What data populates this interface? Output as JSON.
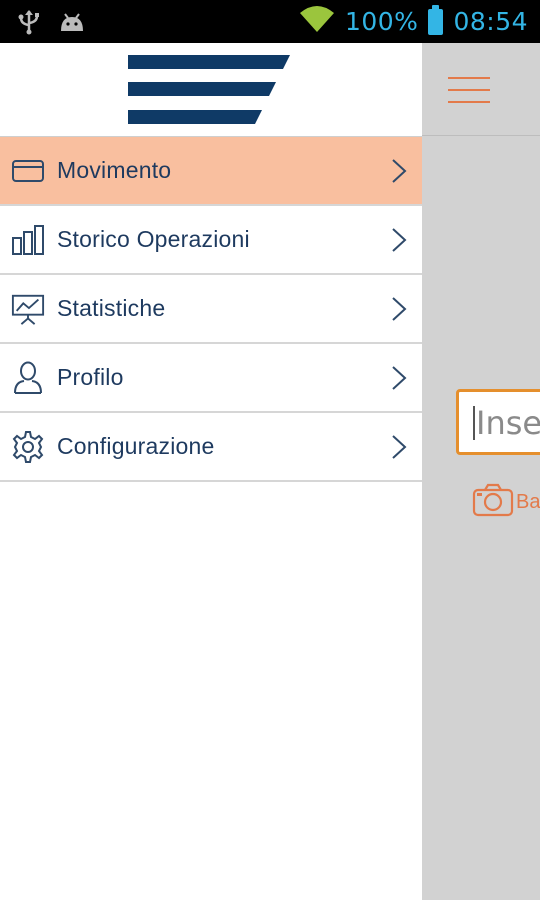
{
  "status_bar": {
    "battery_text": "100%",
    "time": "08:54",
    "icons": [
      "usb-icon",
      "android-debug-icon",
      "wifi-icon",
      "battery-icon"
    ],
    "text_color": "#33b5e5"
  },
  "drawer": {
    "logo": "app-logo",
    "brand_color": "#0f3a66",
    "active_color": "#f9bf9f",
    "items": [
      {
        "label": "Movimento",
        "icon": "card-icon",
        "active": true
      },
      {
        "label": "Storico Operazioni",
        "icon": "bar-chart-icon",
        "active": false
      },
      {
        "label": "Statistiche",
        "icon": "presentation-chart-icon",
        "active": false
      },
      {
        "label": "Profilo",
        "icon": "user-icon",
        "active": false
      },
      {
        "label": "Configurazione",
        "icon": "gear-icon",
        "active": false
      }
    ]
  },
  "background_screen": {
    "input_placeholder": "Inse",
    "camera_label": "Ba",
    "accent_color": "#e37a4a"
  }
}
